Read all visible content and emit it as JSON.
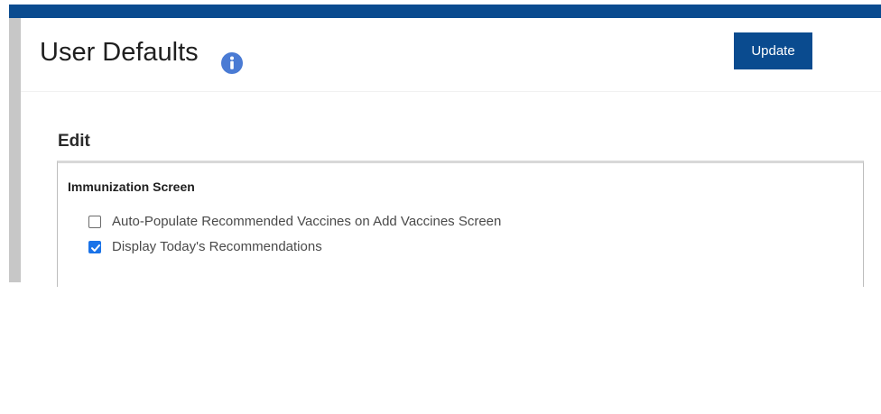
{
  "header": {
    "title": "User Defaults",
    "info_icon": "info-icon",
    "update_label": "Update"
  },
  "edit": {
    "heading": "Edit",
    "section": {
      "heading": "Immunization Screen",
      "options": [
        {
          "label": "Auto-Populate Recommended Vaccines on Add Vaccines Screen",
          "checked": false
        },
        {
          "label": "Display Today's Recommendations",
          "checked": true
        }
      ]
    }
  },
  "colors": {
    "brand": "#0a4b8f",
    "checkbox_checked": "#1a73e8",
    "info_icon": "#4a7bd4"
  }
}
